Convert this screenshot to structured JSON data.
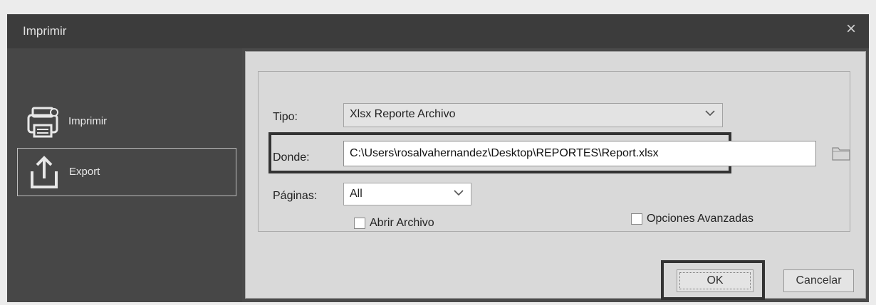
{
  "window": {
    "title": "Imprimir",
    "close_glyph": "×"
  },
  "sidebar": {
    "items": [
      {
        "label": "Imprimir",
        "icon": "printer-icon",
        "selected": false
      },
      {
        "label": "Export",
        "icon": "export-icon",
        "selected": true
      }
    ]
  },
  "form": {
    "tipo_label": "Tipo:",
    "tipo_value": "Xlsx Reporte Archivo",
    "donde_label": "Donde:",
    "donde_value": "C:\\Users\\rosalvahernandez\\Desktop\\REPORTES\\Report.xlsx",
    "paginas_label": "Páginas:",
    "paginas_value": "All",
    "abrir_archivo_label": "Abrir Archivo",
    "abrir_archivo_checked": false,
    "opciones_avanzadas_label": "Opciones Avanzadas",
    "opciones_avanzadas_checked": false
  },
  "buttons": {
    "ok_label": "OK",
    "cancel_label": "Cancelar"
  }
}
